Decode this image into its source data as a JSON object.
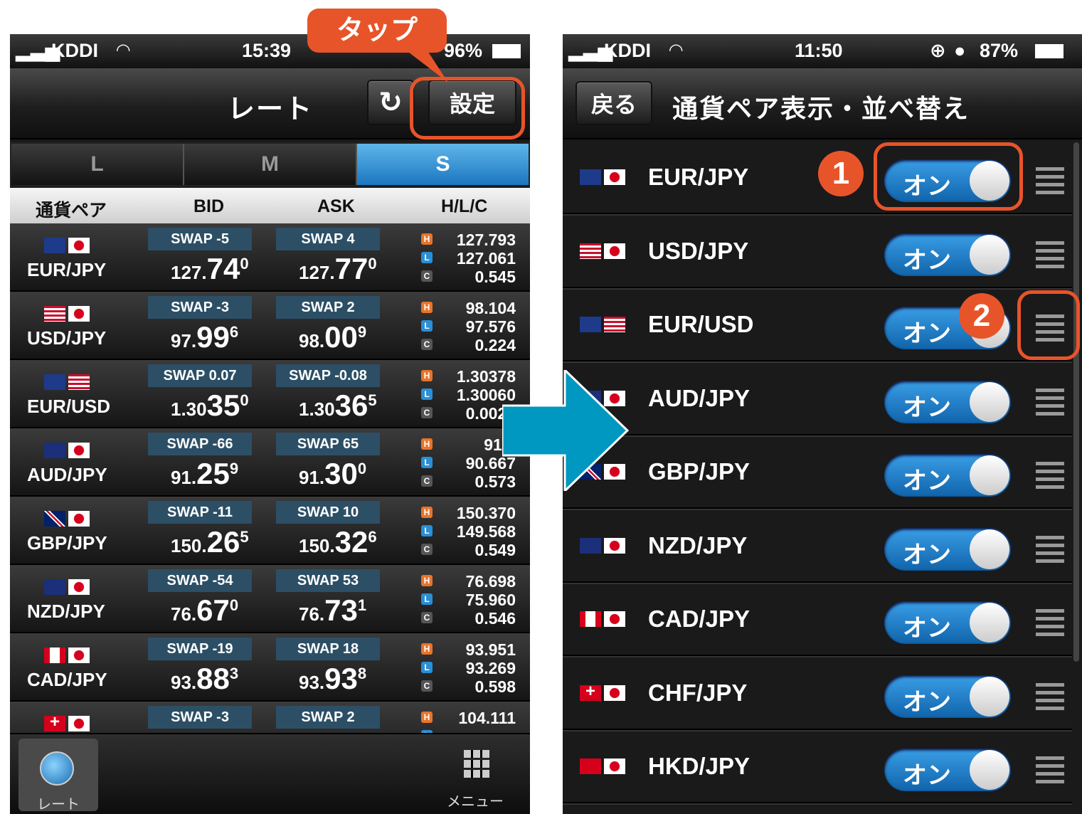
{
  "colors": {
    "accent": "#e8542a",
    "blue": "#1b76c0",
    "arrow": "#0097c0"
  },
  "callout": {
    "tap": "タップ",
    "one": "1",
    "two": "2"
  },
  "left": {
    "status": {
      "carrier": "KDDI",
      "time": "15:39",
      "battery": "96%"
    },
    "nav": {
      "title": "レート",
      "settings": "設定"
    },
    "segments": [
      "L",
      "M",
      "S"
    ],
    "columns": {
      "pair": "通貨ペア",
      "bid": "BID",
      "ask": "ASK",
      "hlc": "H/L/C"
    },
    "hlc_labels": {
      "h": "H",
      "l": "L",
      "c": "C"
    },
    "rows": [
      {
        "pair": "EUR/JPY",
        "flags": [
          "eu",
          "jp"
        ],
        "swap_bid": "SWAP -5",
        "swap_ask": "SWAP 4",
        "bid_pre": "127.",
        "bid_big": "74",
        "bid_sup": "0",
        "ask_pre": "127.",
        "ask_big": "77",
        "ask_sup": "0",
        "h": "127.793",
        "l": "127.061",
        "c": "0.545"
      },
      {
        "pair": "USD/JPY",
        "flags": [
          "us",
          "jp"
        ],
        "swap_bid": "SWAP -3",
        "swap_ask": "SWAP 2",
        "bid_pre": "97.",
        "bid_big": "99",
        "bid_sup": "6",
        "ask_pre": "98.",
        "ask_big": "00",
        "ask_sup": "9",
        "h": "98.104",
        "l": "97.576",
        "c": "0.224"
      },
      {
        "pair": "EUR/USD",
        "flags": [
          "eu",
          "us"
        ],
        "swap_bid": "SWAP 0.07",
        "swap_ask": "SWAP -0.08",
        "bid_pre": "1.30",
        "bid_big": "35",
        "bid_sup": "0",
        "ask_pre": "1.30",
        "ask_big": "36",
        "ask_sup": "5",
        "h": "1.30378",
        "l": "1.30060",
        "c": "0.0025"
      },
      {
        "pair": "AUD/JPY",
        "flags": [
          "au",
          "jp"
        ],
        "swap_bid": "SWAP -66",
        "swap_ask": "SWAP 65",
        "bid_pre": "91.",
        "bid_big": "25",
        "bid_sup": "9",
        "ask_pre": "91.",
        "ask_big": "30",
        "ask_sup": "0",
        "h": "91.2",
        "l": "90.667",
        "c": "0.573"
      },
      {
        "pair": "GBP/JPY",
        "flags": [
          "gb",
          "jp"
        ],
        "swap_bid": "SWAP -11",
        "swap_ask": "SWAP 10",
        "bid_pre": "150.",
        "bid_big": "26",
        "bid_sup": "5",
        "ask_pre": "150.",
        "ask_big": "32",
        "ask_sup": "6",
        "h": "150.370",
        "l": "149.568",
        "c": "0.549"
      },
      {
        "pair": "NZD/JPY",
        "flags": [
          "nz",
          "jp"
        ],
        "swap_bid": "SWAP -54",
        "swap_ask": "SWAP 53",
        "bid_pre": "76.",
        "bid_big": "67",
        "bid_sup": "0",
        "ask_pre": "76.",
        "ask_big": "73",
        "ask_sup": "1",
        "h": "76.698",
        "l": "75.960",
        "c": "0.546"
      },
      {
        "pair": "CAD/JPY",
        "flags": [
          "ca",
          "jp"
        ],
        "swap_bid": "SWAP -19",
        "swap_ask": "SWAP 18",
        "bid_pre": "93.",
        "bid_big": "88",
        "bid_sup": "3",
        "ask_pre": "93.",
        "ask_big": "93",
        "ask_sup": "8",
        "h": "93.951",
        "l": "93.269",
        "c": "0.598"
      },
      {
        "pair": "",
        "flags": [
          "ch",
          "jp"
        ],
        "swap_bid": "SWAP -3",
        "swap_ask": "SWAP 2",
        "bid_pre": "",
        "bid_big": "",
        "bid_sup": "",
        "ask_pre": "",
        "ask_big": "",
        "ask_sup": "",
        "h": "104.111",
        "l": "",
        "c": ""
      }
    ],
    "tabbar": {
      "rate": "レート",
      "menu": "メニュー"
    }
  },
  "right": {
    "status": {
      "carrier": "KDDI",
      "time": "11:50",
      "battery": "87%"
    },
    "nav": {
      "back": "戻る",
      "title": "通貨ペア表示・並べ替え"
    },
    "toggle_label": "オン",
    "items": [
      {
        "pair": "EUR/JPY",
        "flags": [
          "eu",
          "jp"
        ]
      },
      {
        "pair": "USD/JPY",
        "flags": [
          "us",
          "jp"
        ]
      },
      {
        "pair": "EUR/USD",
        "flags": [
          "eu",
          "us"
        ]
      },
      {
        "pair": "AUD/JPY",
        "flags": [
          "au",
          "jp"
        ]
      },
      {
        "pair": "GBP/JPY",
        "flags": [
          "gb",
          "jp"
        ]
      },
      {
        "pair": "NZD/JPY",
        "flags": [
          "nz",
          "jp"
        ]
      },
      {
        "pair": "CAD/JPY",
        "flags": [
          "ca",
          "jp"
        ]
      },
      {
        "pair": "CHF/JPY",
        "flags": [
          "ch",
          "jp"
        ]
      },
      {
        "pair": "HKD/JPY",
        "flags": [
          "hk",
          "jp"
        ]
      }
    ]
  }
}
